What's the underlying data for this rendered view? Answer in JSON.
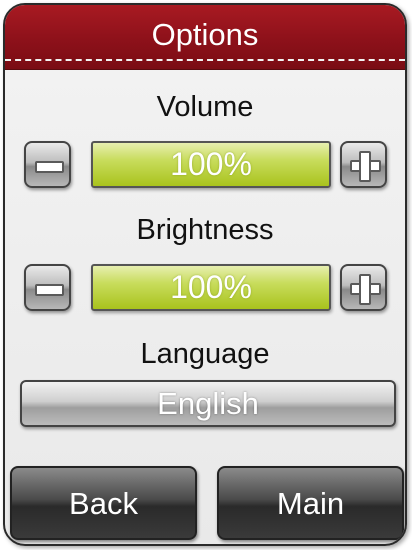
{
  "header": {
    "title": "Options"
  },
  "volume": {
    "label": "Volume",
    "value_text": "100%",
    "level": 1.0
  },
  "brightness": {
    "label": "Brightness",
    "value_text": "100%",
    "level": 1.0
  },
  "language": {
    "label": "Language",
    "value": "English"
  },
  "footer": {
    "back_label": "Back",
    "main_label": "Main"
  },
  "colors": {
    "header": "#9a1520",
    "level_bar": "#b6cc2e",
    "panel_bg": "#efefef",
    "footer_button": "#3a3a3a"
  },
  "icons": {
    "decrease": "minus-icon",
    "increase": "plus-icon"
  }
}
